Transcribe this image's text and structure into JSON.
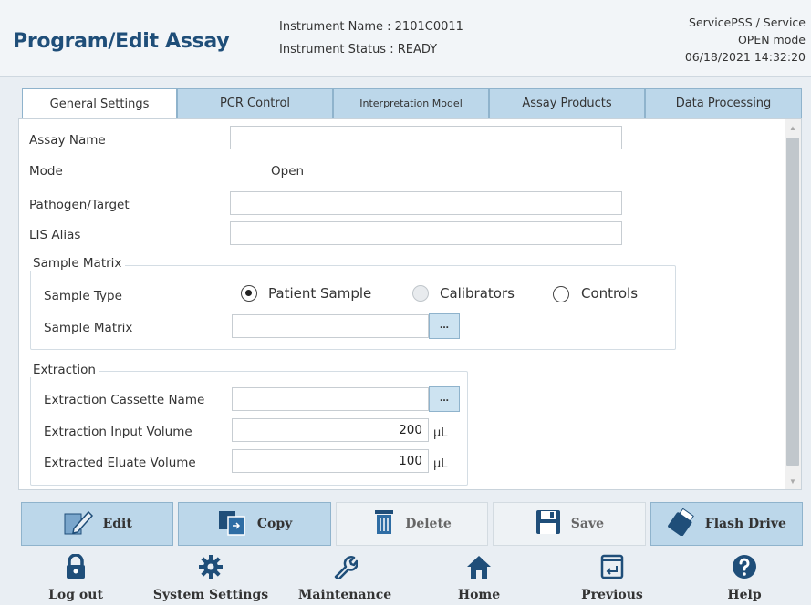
{
  "header": {
    "title": "Program/Edit Assay",
    "instrument_name": "Instrument Name : 2101C0011",
    "instrument_status": "Instrument Status : READY",
    "user": "ServicePSS / Service",
    "mode": "OPEN mode",
    "datetime": "06/18/2021 14:32:20"
  },
  "tabs": [
    {
      "label": "General Settings",
      "active": true
    },
    {
      "label": "PCR Control",
      "active": false
    },
    {
      "label": "Interpretation Model",
      "active": false
    },
    {
      "label": "Assay Products",
      "active": false
    },
    {
      "label": "Data Processing",
      "active": false
    }
  ],
  "general": {
    "assay_name_label": "Assay Name",
    "assay_name_value": "",
    "mode_label": "Mode",
    "mode_value": "Open",
    "pathogen_label": "Pathogen/Target",
    "pathogen_value": "",
    "lis_alias_label": "LIS Alias",
    "lis_alias_value": ""
  },
  "sample_matrix_group": {
    "title": "Sample Matrix",
    "sample_type_label": "Sample Type",
    "options": [
      {
        "label": "Patient Sample",
        "checked": true,
        "disabled": false
      },
      {
        "label": "Calibrators",
        "checked": false,
        "disabled": true
      },
      {
        "label": "Controls",
        "checked": false,
        "disabled": false
      }
    ],
    "sample_matrix_label": "Sample Matrix",
    "sample_matrix_value": "",
    "browse_label": "..."
  },
  "extraction_group": {
    "title": "Extraction",
    "cassette_label": "Extraction Cassette Name",
    "cassette_value": "",
    "browse_label": "...",
    "input_volume_label": "Extraction Input Volume",
    "input_volume_value": "200",
    "input_volume_unit": "µL",
    "eluate_volume_label": "Extracted Eluate Volume",
    "eluate_volume_value": "100",
    "eluate_volume_unit": "µL"
  },
  "actions": [
    {
      "label": "Edit",
      "icon": "pencil-icon",
      "enabled": true
    },
    {
      "label": "Copy",
      "icon": "copy-icon",
      "enabled": true
    },
    {
      "label": "Delete",
      "icon": "trash-icon",
      "enabled": false
    },
    {
      "label": "Save",
      "icon": "floppy-icon",
      "enabled": false
    },
    {
      "label": "Flash Drive",
      "icon": "usb-drive-icon",
      "enabled": true
    }
  ],
  "nav": [
    {
      "label": "Log out",
      "icon": "lock-icon"
    },
    {
      "label": "System Settings",
      "icon": "gear-icon"
    },
    {
      "label": "Maintenance",
      "icon": "wrench-icon"
    },
    {
      "label": "Home",
      "icon": "home-icon"
    },
    {
      "label": "Previous",
      "icon": "previous-icon"
    },
    {
      "label": "Help",
      "icon": "help-icon"
    }
  ],
  "colors": {
    "accent": "#1f4e79",
    "icon_blue": "#1f4e79",
    "tab_bg": "#bcd7ea"
  }
}
